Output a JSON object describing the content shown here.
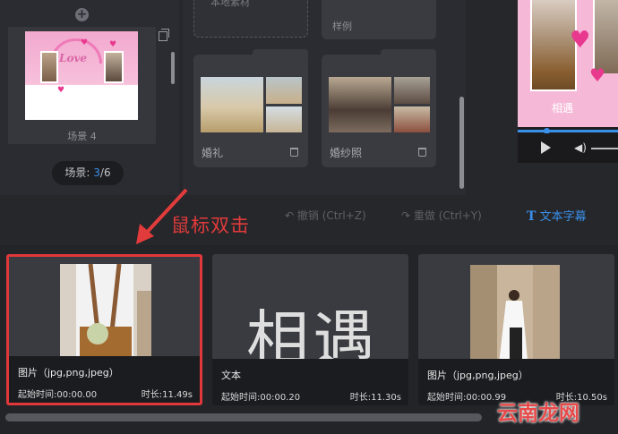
{
  "scene_panel": {
    "add_icon": "plus-circle-icon",
    "scene_label": "场景 4",
    "thumb_text": "Love",
    "counter_prefix": "场景: ",
    "counter_current": "3",
    "counter_total": "/6"
  },
  "templates": {
    "top_left_label": "本地素材",
    "top_right_label": "样例",
    "folders": [
      {
        "name": "婚礼"
      },
      {
        "name": "婚纱照"
      }
    ]
  },
  "preview": {
    "caption": "相遇"
  },
  "toolbar": {
    "undo": "撤销 (Ctrl+Z)",
    "redo": "重做 (Ctrl+Y)",
    "text_subtitle": "文本字幕",
    "text_icon": "T"
  },
  "annotation": {
    "text": "鼠标双击"
  },
  "timeline": {
    "clips": [
      {
        "type": "图片（jpg,png,jpeg）",
        "start": "起始时间:00:00.00",
        "duration": "时长:11.49s"
      },
      {
        "type": "文本",
        "start": "起始时间:00:00.20",
        "duration": "时长:11.30s",
        "text": "相遇"
      },
      {
        "type": "图片（jpg,png,jpeg）",
        "start": "起始时间:00:00.99",
        "duration": "时长:10.50s"
      }
    ]
  },
  "watermark": "云南龙网",
  "colors": {
    "accent": "#3a8fe8",
    "selection": "#e0383b"
  }
}
